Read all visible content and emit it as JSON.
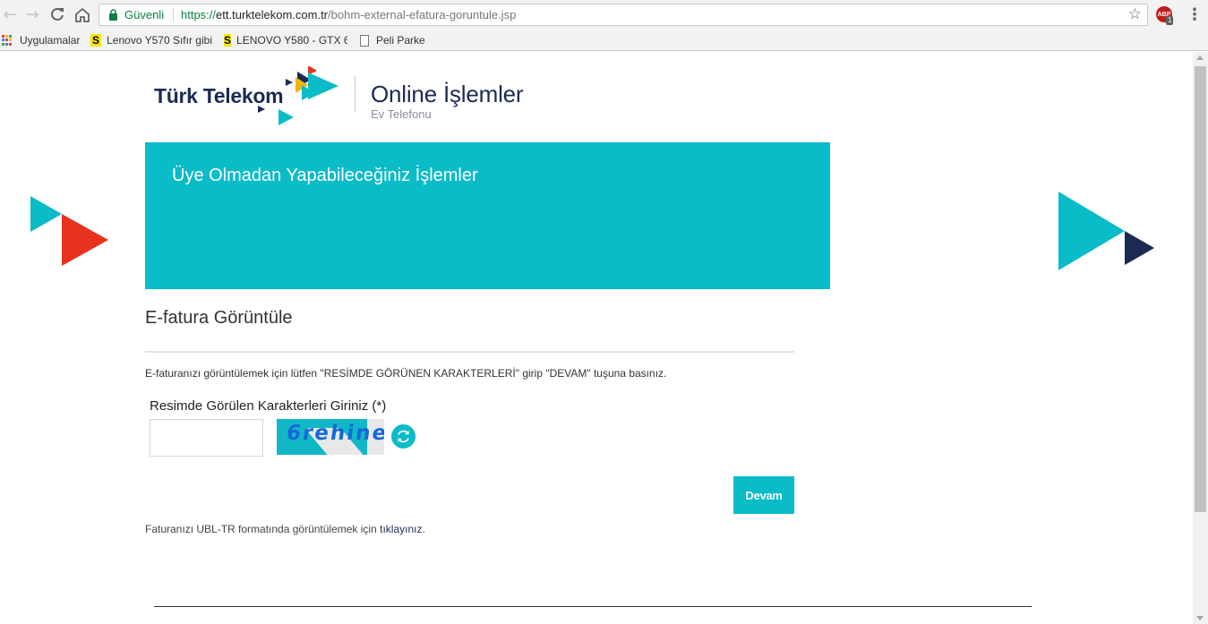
{
  "browser": {
    "secure_label": "Güvenli",
    "url_scheme": "https://",
    "url_host": "ett.turktelekom.com.tr",
    "url_path": "/bohm-external-efatura-goruntule.jsp",
    "extension_badge": "ABP",
    "extension_count": "1",
    "icons": [
      "back-icon",
      "forward-icon",
      "reload-icon",
      "home-icon",
      "lock-icon",
      "star-icon",
      "menu-icon"
    ]
  },
  "bookmarks": {
    "apps_label": "Uygulamalar",
    "items": [
      {
        "label": "Lenovo Y570 Sıfır gibi"
      },
      {
        "label": "LENOVO Y580 - GTX 6"
      },
      {
        "label": "Peli Parke"
      }
    ]
  },
  "header": {
    "logo_text": "Türk Telekom",
    "title": "Online İşlemler",
    "subtitle": "Ev Telefonu"
  },
  "banner": {
    "title": "Üye Olmadan Yapabileceğiniz İşlemler"
  },
  "form": {
    "section_title": "E-fatura Görüntüle",
    "instruction": "E-faturanızı görüntülemek için lütfen \"RESİMDE GÖRÜNEN KARAKTERLERİ\" girip \"DEVAM\" tuşuna basınız.",
    "captcha_label": "Resimde Görülen Karakterleri Giriniz (*)",
    "captcha_value": "",
    "captcha_text": "6rehine",
    "submit_label": "Devam",
    "ubl_text": "Faturanızı UBL-TR formatında görüntülemek için ",
    "ubl_link": "tıklayınız."
  },
  "colors": {
    "brand_teal": "#0abbc8",
    "brand_navy": "#1a2b54",
    "brand_red": "#e8321e"
  }
}
